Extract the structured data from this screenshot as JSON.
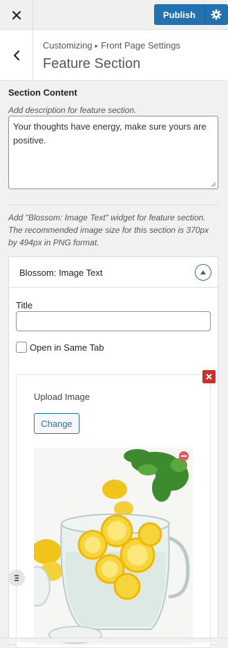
{
  "toolbar": {
    "close_label": "Close",
    "publish_label": "Publish"
  },
  "header": {
    "crumb_root": "Customizing",
    "crumb_separator": "▸",
    "crumb_parent": "Front Page Settings",
    "title": "Feature Section"
  },
  "section": {
    "heading": "Section Content",
    "description": "Add description for feature section.",
    "content_value": "Your thoughts have energy, make sure yours are positive.",
    "widget_hint": "Add \"Blossom: Image Text\" widget for feature section. The recommended image size for this section is 370px by 494px in PNG format."
  },
  "widget": {
    "title": "Blossom: Image Text",
    "title_field_label": "Title",
    "title_field_value": "",
    "checkbox_label": "Open in Same Tab",
    "checkbox_checked": false,
    "upload_label": "Upload Image",
    "change_button": "Change",
    "image_description": "photo of glass pitcher with lemon slices"
  },
  "colors": {
    "accent": "#2271b1",
    "danger": "#c9302c"
  }
}
